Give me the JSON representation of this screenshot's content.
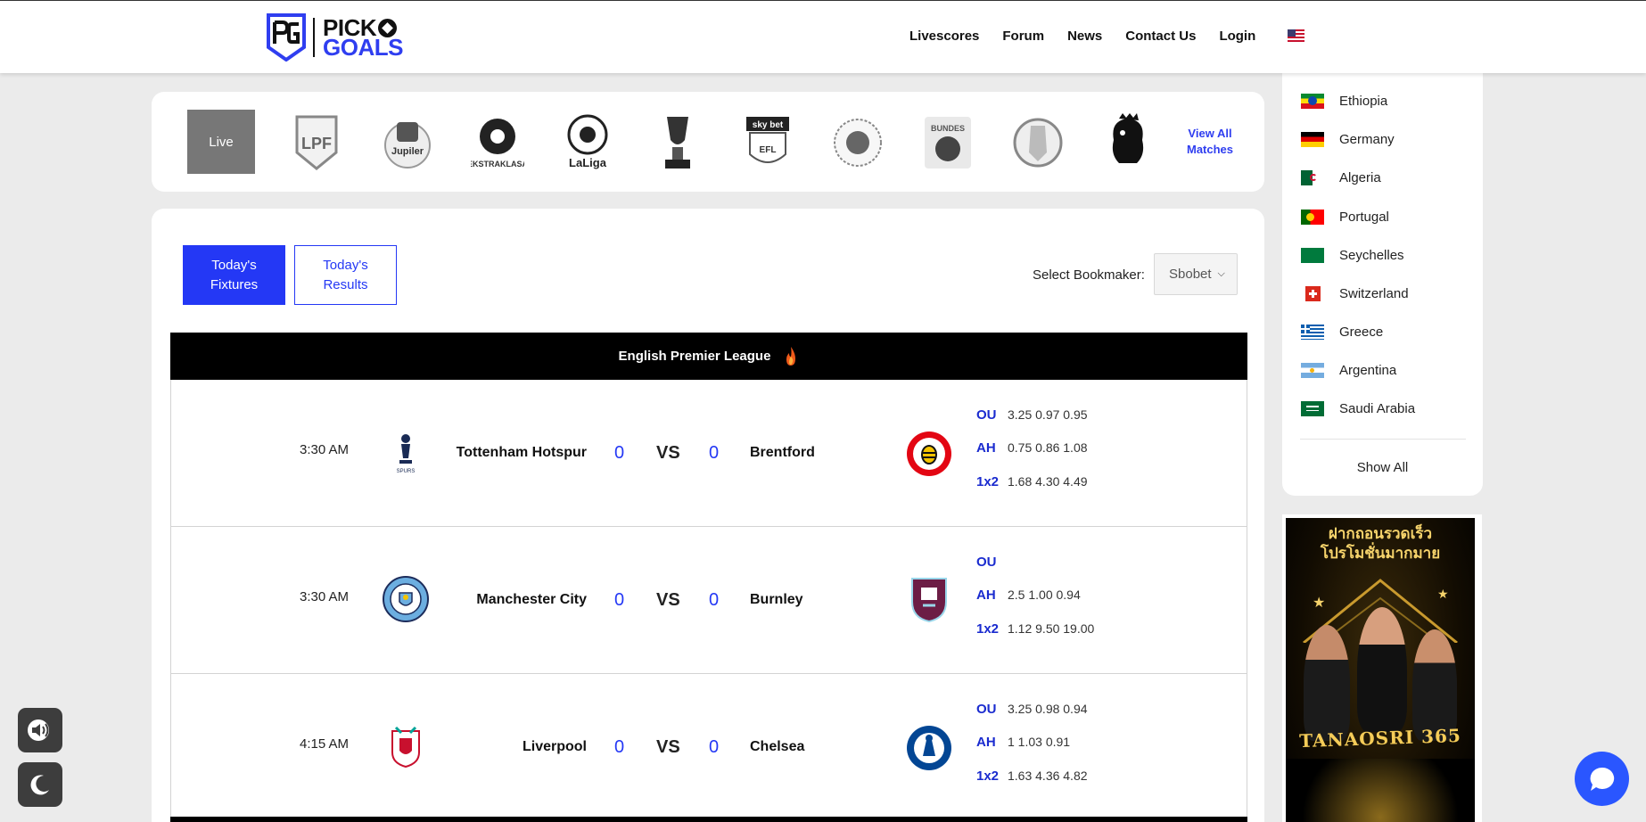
{
  "header": {
    "logo": {
      "word1": "PICK",
      "word2": "GOALS",
      "badge": "PG"
    },
    "nav": [
      {
        "label": "Livescores"
      },
      {
        "label": "Forum"
      },
      {
        "label": "News"
      },
      {
        "label": "Contact Us"
      },
      {
        "label": "Login"
      }
    ],
    "language_flag": "us-flag-icon"
  },
  "league_strip": {
    "live_label": "Live",
    "leagues": [
      {
        "name": "LPF",
        "icon": "lpf-league-icon"
      },
      {
        "name": "Jupiler Pro League",
        "icon": "jupiler-league-icon"
      },
      {
        "name": "Ekstraklasa",
        "icon": "ekstraklasa-league-icon"
      },
      {
        "name": "LaLiga",
        "icon": "laliga-league-icon"
      },
      {
        "name": "Asian Cup",
        "icon": "asian-cup-icon"
      },
      {
        "name": "EFL Championship",
        "icon": "efl-championship-icon"
      },
      {
        "name": "Indian Super League",
        "icon": "indian-super-league-icon"
      },
      {
        "name": "Bundesliga",
        "icon": "bundesliga-icon"
      },
      {
        "name": "Brasileirao",
        "icon": "brasileirao-icon"
      },
      {
        "name": "Premier League",
        "icon": "premier-league-icon"
      }
    ],
    "view_all_line1": "View All",
    "view_all_line2": "Matches"
  },
  "main": {
    "tabs": [
      {
        "line1": "Today's",
        "line2": "Fixtures",
        "active": true
      },
      {
        "line1": "Today's",
        "line2": "Results",
        "active": false
      }
    ],
    "bookmaker_label": "Select Bookmaker:",
    "bookmaker_value": "Sbobet",
    "league_title": "English Premier League",
    "matches": [
      {
        "time": "3:30 AM",
        "home": "Tottenham Hotspur",
        "home_score": "0",
        "vs": "VS",
        "away": "Brentford",
        "away_score": "0",
        "ou_label": "OU",
        "ou": "3.25 0.97 0.95",
        "ah_label": "AH",
        "ah": "0.75 0.86 1.08",
        "x12_label": "1x2",
        "x12": "1.68 4.30 4.49"
      },
      {
        "time": "3:30 AM",
        "home": "Manchester City",
        "home_score": "0",
        "vs": "VS",
        "away": "Burnley",
        "away_score": "0",
        "ou_label": "OU",
        "ou": "",
        "ah_label": "AH",
        "ah": "2.5 1.00 0.94",
        "x12_label": "1x2",
        "x12": "1.12 9.50 19.00"
      },
      {
        "time": "4:15 AM",
        "home": "Liverpool",
        "home_score": "0",
        "vs": "VS",
        "away": "Chelsea",
        "away_score": "0",
        "ou_label": "OU",
        "ou": "3.25 0.98 0.94",
        "ah_label": "AH",
        "ah": "1 1.03 0.91",
        "x12_label": "1x2",
        "x12": "1.63 4.36 4.82"
      }
    ]
  },
  "sidebar": {
    "countries": [
      {
        "name": "Ethiopia"
      },
      {
        "name": "Germany"
      },
      {
        "name": "Algeria"
      },
      {
        "name": "Portugal"
      },
      {
        "name": "Seychelles"
      },
      {
        "name": "Switzerland"
      },
      {
        "name": "Greece"
      },
      {
        "name": "Argentina"
      },
      {
        "name": "Saudi Arabia"
      }
    ],
    "show_all": "Show All"
  },
  "ad": {
    "line1": "ฝากถอนรวดเร็ว",
    "line2": "โปรโมชั่นมากมาย",
    "brand": "TANAOSRI 365"
  },
  "colors": {
    "accent": "#2438f5",
    "live_button": "#777777",
    "league_bar": "#000000",
    "chat": "#2a56ff"
  }
}
